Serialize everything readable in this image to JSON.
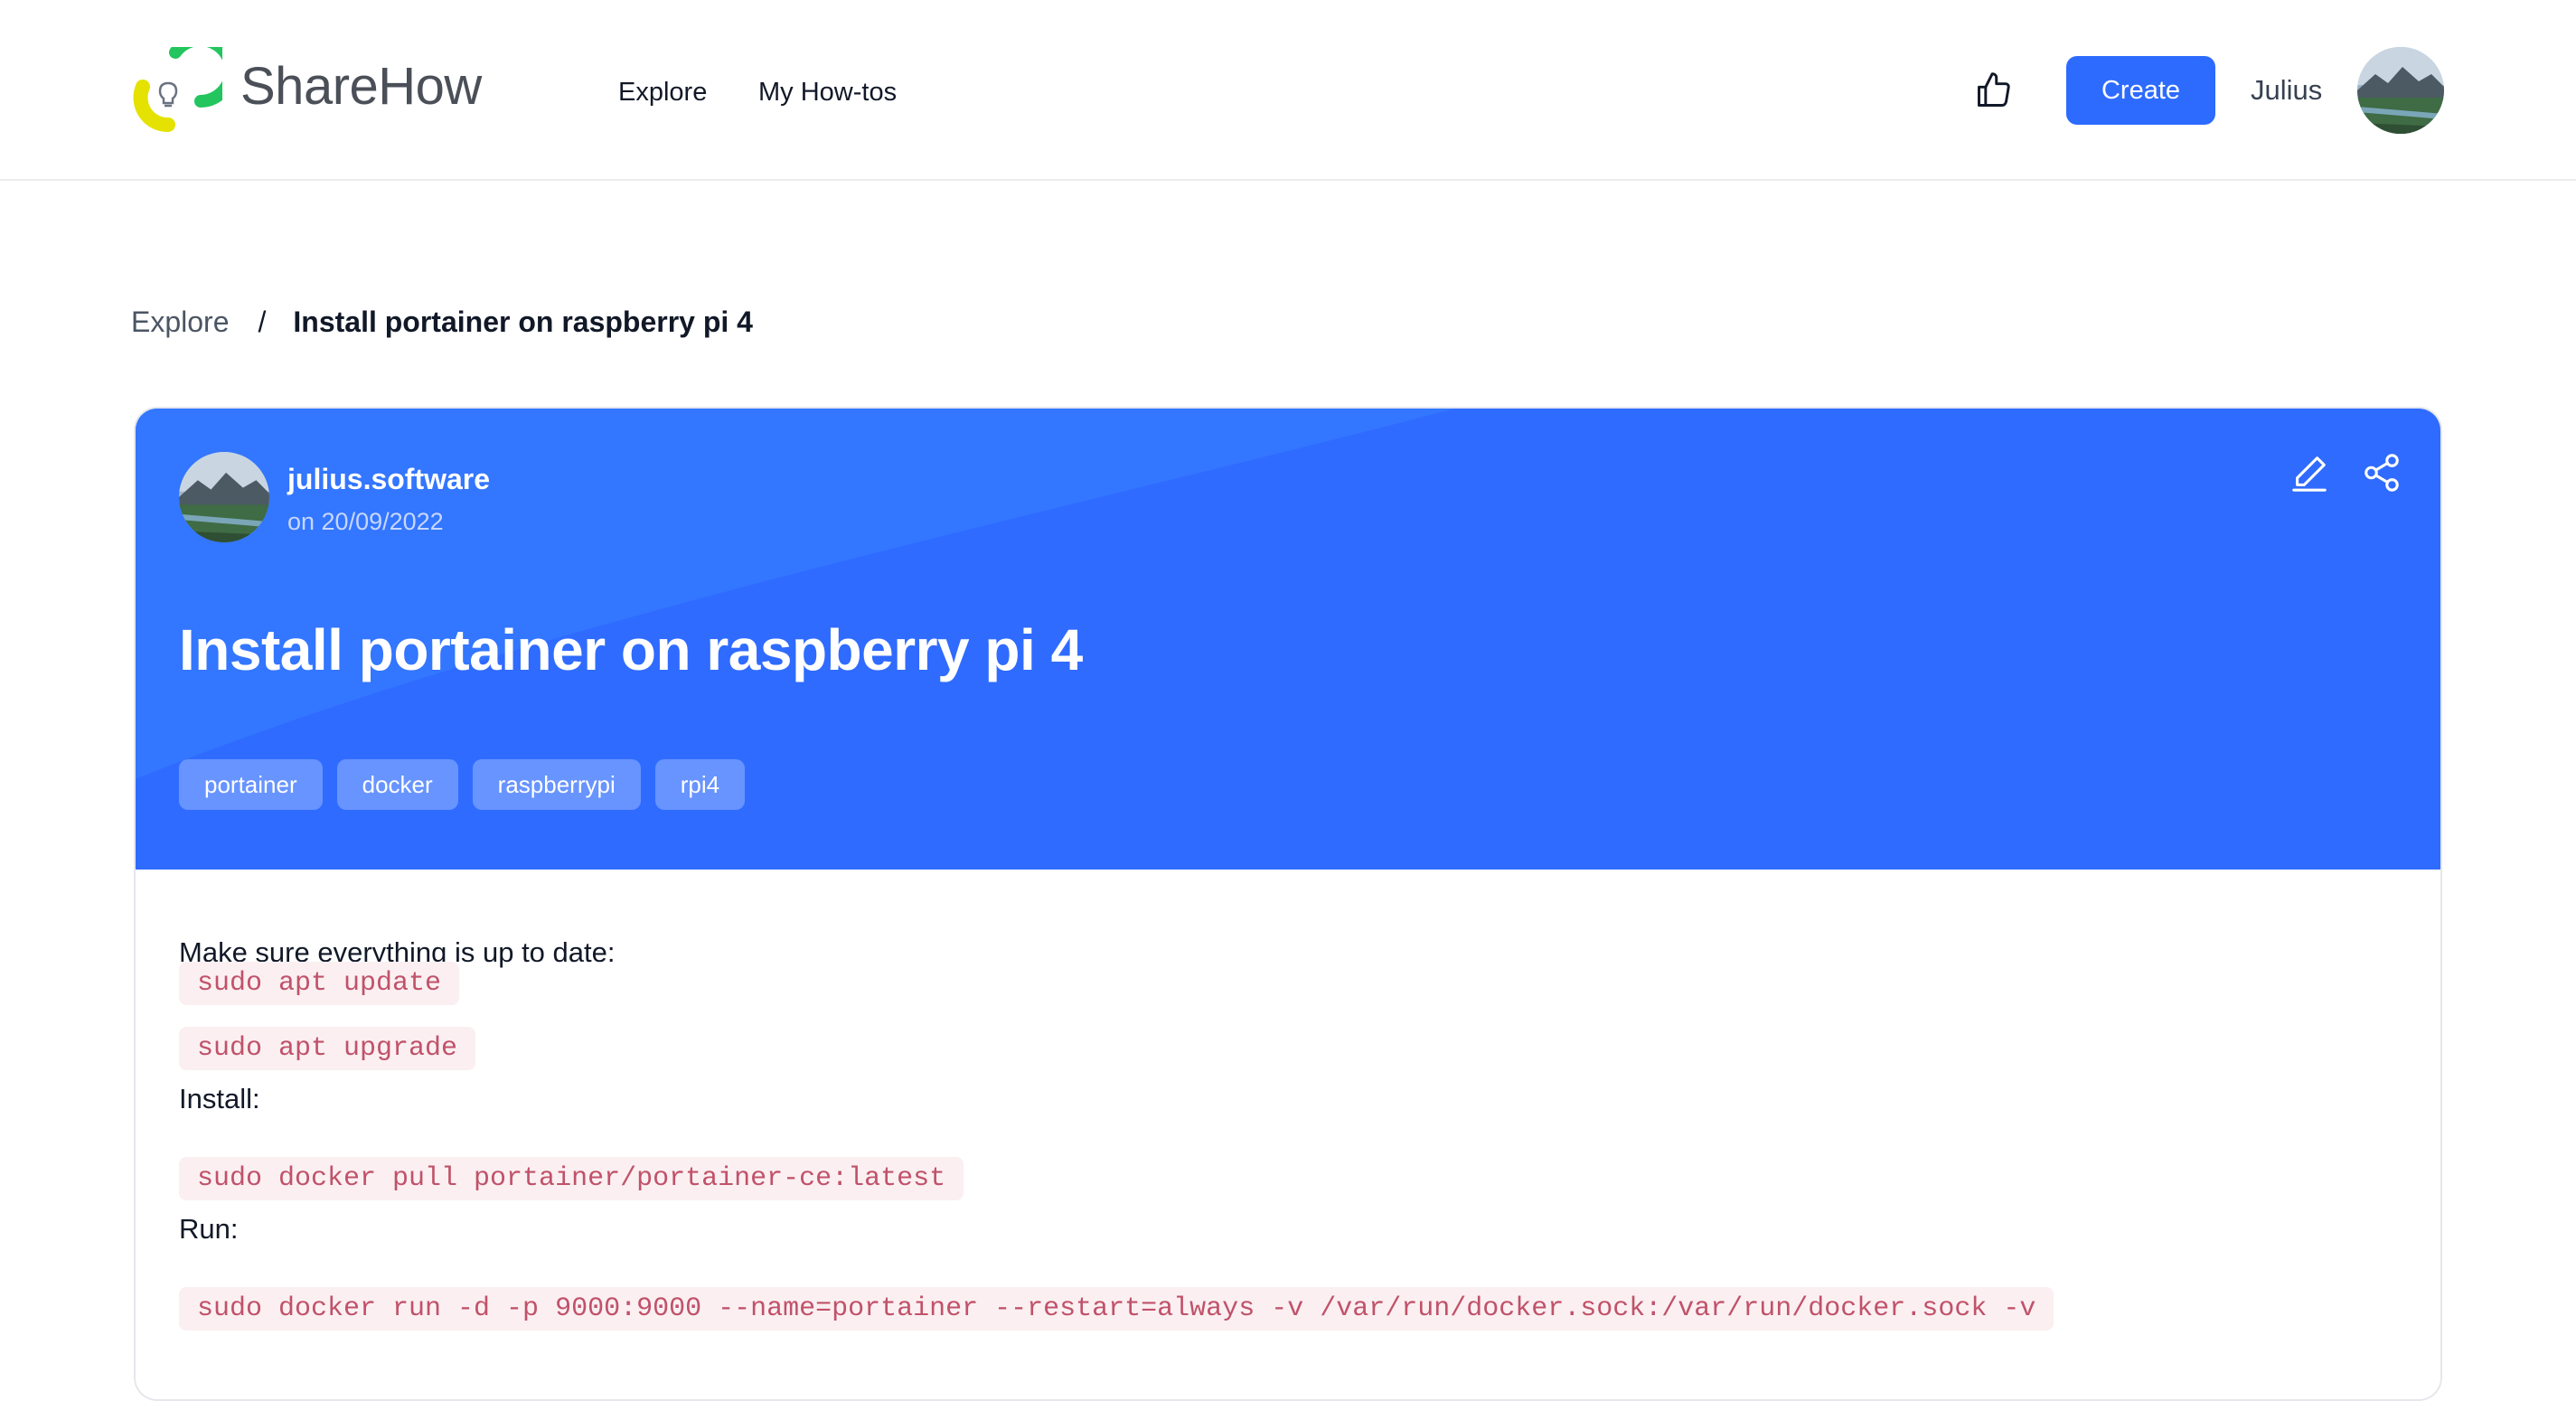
{
  "header": {
    "brand": "ShareHow",
    "nav": [
      {
        "label": "Explore"
      },
      {
        "label": "My How-tos"
      }
    ],
    "create_label": "Create",
    "user_name": "Julius",
    "icons": {
      "like": "thumbs-up-icon",
      "logo": "lightbulb-logo-icon"
    }
  },
  "breadcrumb": {
    "root": "Explore",
    "separator": "/",
    "current": "Install portainer on raspberry pi 4"
  },
  "post": {
    "author": "julius.software",
    "date": "on 20/09/2022",
    "title": "Install portainer on raspberry pi 4",
    "tags": [
      "portainer",
      "docker",
      "raspberrypi",
      "rpi4"
    ],
    "icons": {
      "edit": "pencil-icon",
      "share": "share-icon"
    }
  },
  "content": {
    "intro": "Make sure everything is up to date:",
    "code_update": "sudo apt update",
    "code_upgrade": "sudo apt upgrade",
    "install_label": "Install:",
    "code_pull": "sudo docker pull portainer/portainer-ce:latest",
    "run_label": "Run:",
    "code_run": "sudo docker run -d -p 9000:9000 --name=portainer --restart=always -v /var/run/docker.sock:/var/run/docker.sock -v"
  },
  "colors": {
    "accent": "#2d6bff",
    "hero": "#2f6bff",
    "code_bg": "#fbeff1",
    "code_text": "#c0526a",
    "logo_green": "#22c55e",
    "logo_yellow": "#e5e100"
  }
}
